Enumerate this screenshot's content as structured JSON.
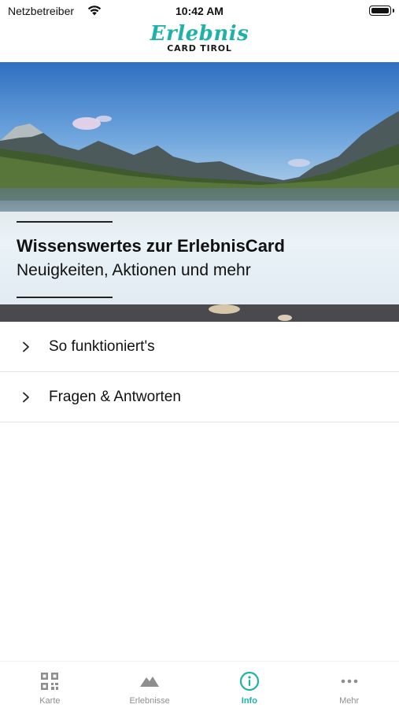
{
  "status_bar": {
    "carrier": "Netzbetreiber",
    "time": "10:42 AM"
  },
  "header": {
    "logo_script": "Erlebnis",
    "logo_sub": "CARD TIROL"
  },
  "hero": {
    "title": "Wissenswertes zur ErlebnisCard",
    "subtitle": "Neuigkeiten, Aktionen und mehr"
  },
  "list": {
    "items": [
      {
        "label": "So funktioniert's"
      },
      {
        "label": "Fragen & Antworten"
      }
    ]
  },
  "tab_bar": {
    "active": "info",
    "accent_color": "#1fb3a7",
    "inactive_color": "#8e8e8e",
    "tabs": [
      {
        "label": "Karte",
        "icon": "qr-code-icon"
      },
      {
        "label": "Erlebnisse",
        "icon": "mountain-icon"
      },
      {
        "label": "Info",
        "icon": "info-icon"
      },
      {
        "label": "Mehr",
        "icon": "more-dots-icon"
      }
    ]
  }
}
